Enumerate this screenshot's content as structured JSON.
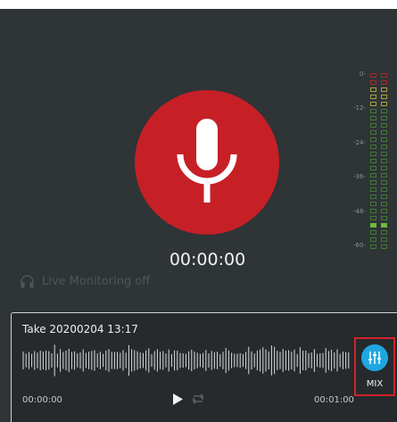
{
  "timer": "00:00:00",
  "monitoring": {
    "label": "Live Monitoring off",
    "icon": "headphones-icon"
  },
  "meter": {
    "labels": [
      "0-",
      "-12-",
      "-24-",
      "-36-",
      "-48-",
      "-60-"
    ],
    "colors": {
      "red": "#a02a2a",
      "yellow": "#a8a23a",
      "green": "#3f7a33",
      "active_green": "#6dbb3d"
    }
  },
  "take": {
    "title": "Take 20200204 13:17",
    "time_start": "00:00:00",
    "time_end": "00:01:00",
    "mix_label": "MIX"
  },
  "colors": {
    "record": "#c62026",
    "mix": "#1fa7e2",
    "highlight": "#d2232a"
  },
  "icons": {
    "record": "microphone-icon",
    "play": "play-icon",
    "repeat": "repeat-icon",
    "mix": "mixer-sliders-icon"
  }
}
